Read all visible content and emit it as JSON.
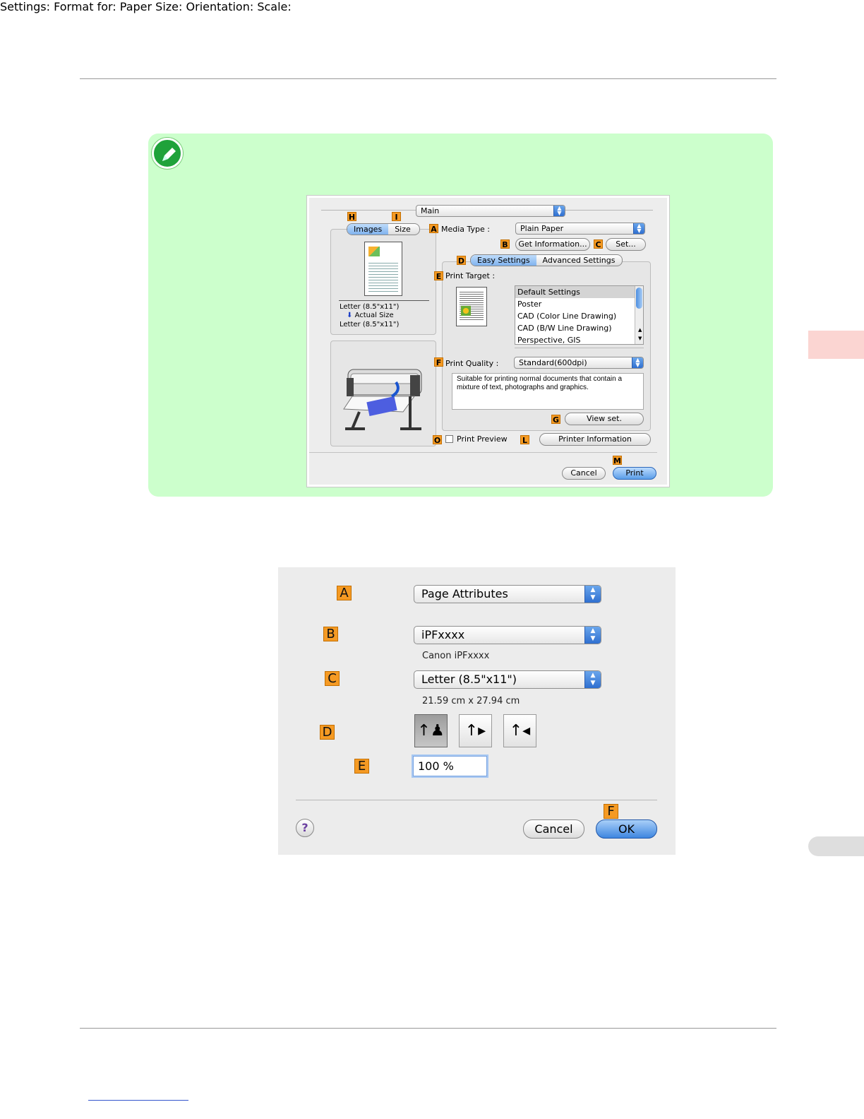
{
  "small_dialog": {
    "main_popup": "Main",
    "tabs": {
      "h": "H",
      "i": "I",
      "images": "Images",
      "size": "Size"
    },
    "media_type": {
      "letter": "A",
      "label": "Media Type :",
      "value": "Plain Paper"
    },
    "get_info": {
      "letter": "B",
      "label": "Get Information..."
    },
    "set": {
      "letter": "C",
      "label": "Set..."
    },
    "settings_tabs": {
      "letter": "D",
      "easy": "Easy Settings",
      "advanced": "Advanced Settings"
    },
    "print_target": {
      "letter": "E",
      "label": "Print Target :",
      "items": [
        "Default Settings",
        "Poster",
        "CAD (Color Line Drawing)",
        "CAD (B/W Line Drawing)",
        "Perspective, GIS"
      ]
    },
    "preview_text": {
      "line1": "Letter (8.5\"x11\")",
      "line2": "Actual Size",
      "line3": "Letter (8.5\"x11\")"
    },
    "print_quality": {
      "letter": "F",
      "label": "Print Quality :",
      "value": "Standard(600dpi)"
    },
    "description": "Suitable for printing normal documents that contain a mixture of text, photographs and graphics.",
    "view_set": {
      "letter": "G",
      "label": "View set."
    },
    "print_preview": {
      "letter": "O",
      "label": "Print Preview"
    },
    "printer_info": {
      "letter": "L",
      "label": "Printer Information"
    },
    "cancel": "Cancel",
    "print": {
      "letter": "M",
      "label": "Print"
    }
  },
  "page_setup": {
    "settings": {
      "letter": "A",
      "label": "Settings:",
      "value": "Page Attributes"
    },
    "format_for": {
      "letter": "B",
      "label": "Format for:",
      "value": "iPFxxxx",
      "sub": "Canon iPFxxxx"
    },
    "paper_size": {
      "letter": "C",
      "label": "Paper Size:",
      "value": "Letter (8.5\"x11\")",
      "sub": "21.59 cm x 27.94 cm"
    },
    "orientation": {
      "letter": "D",
      "label": "Orientation:"
    },
    "scale": {
      "letter": "E",
      "label": "Scale:",
      "value": "100 %"
    },
    "ok": {
      "letter": "F",
      "label": "OK"
    },
    "cancel": "Cancel",
    "help": "?"
  }
}
